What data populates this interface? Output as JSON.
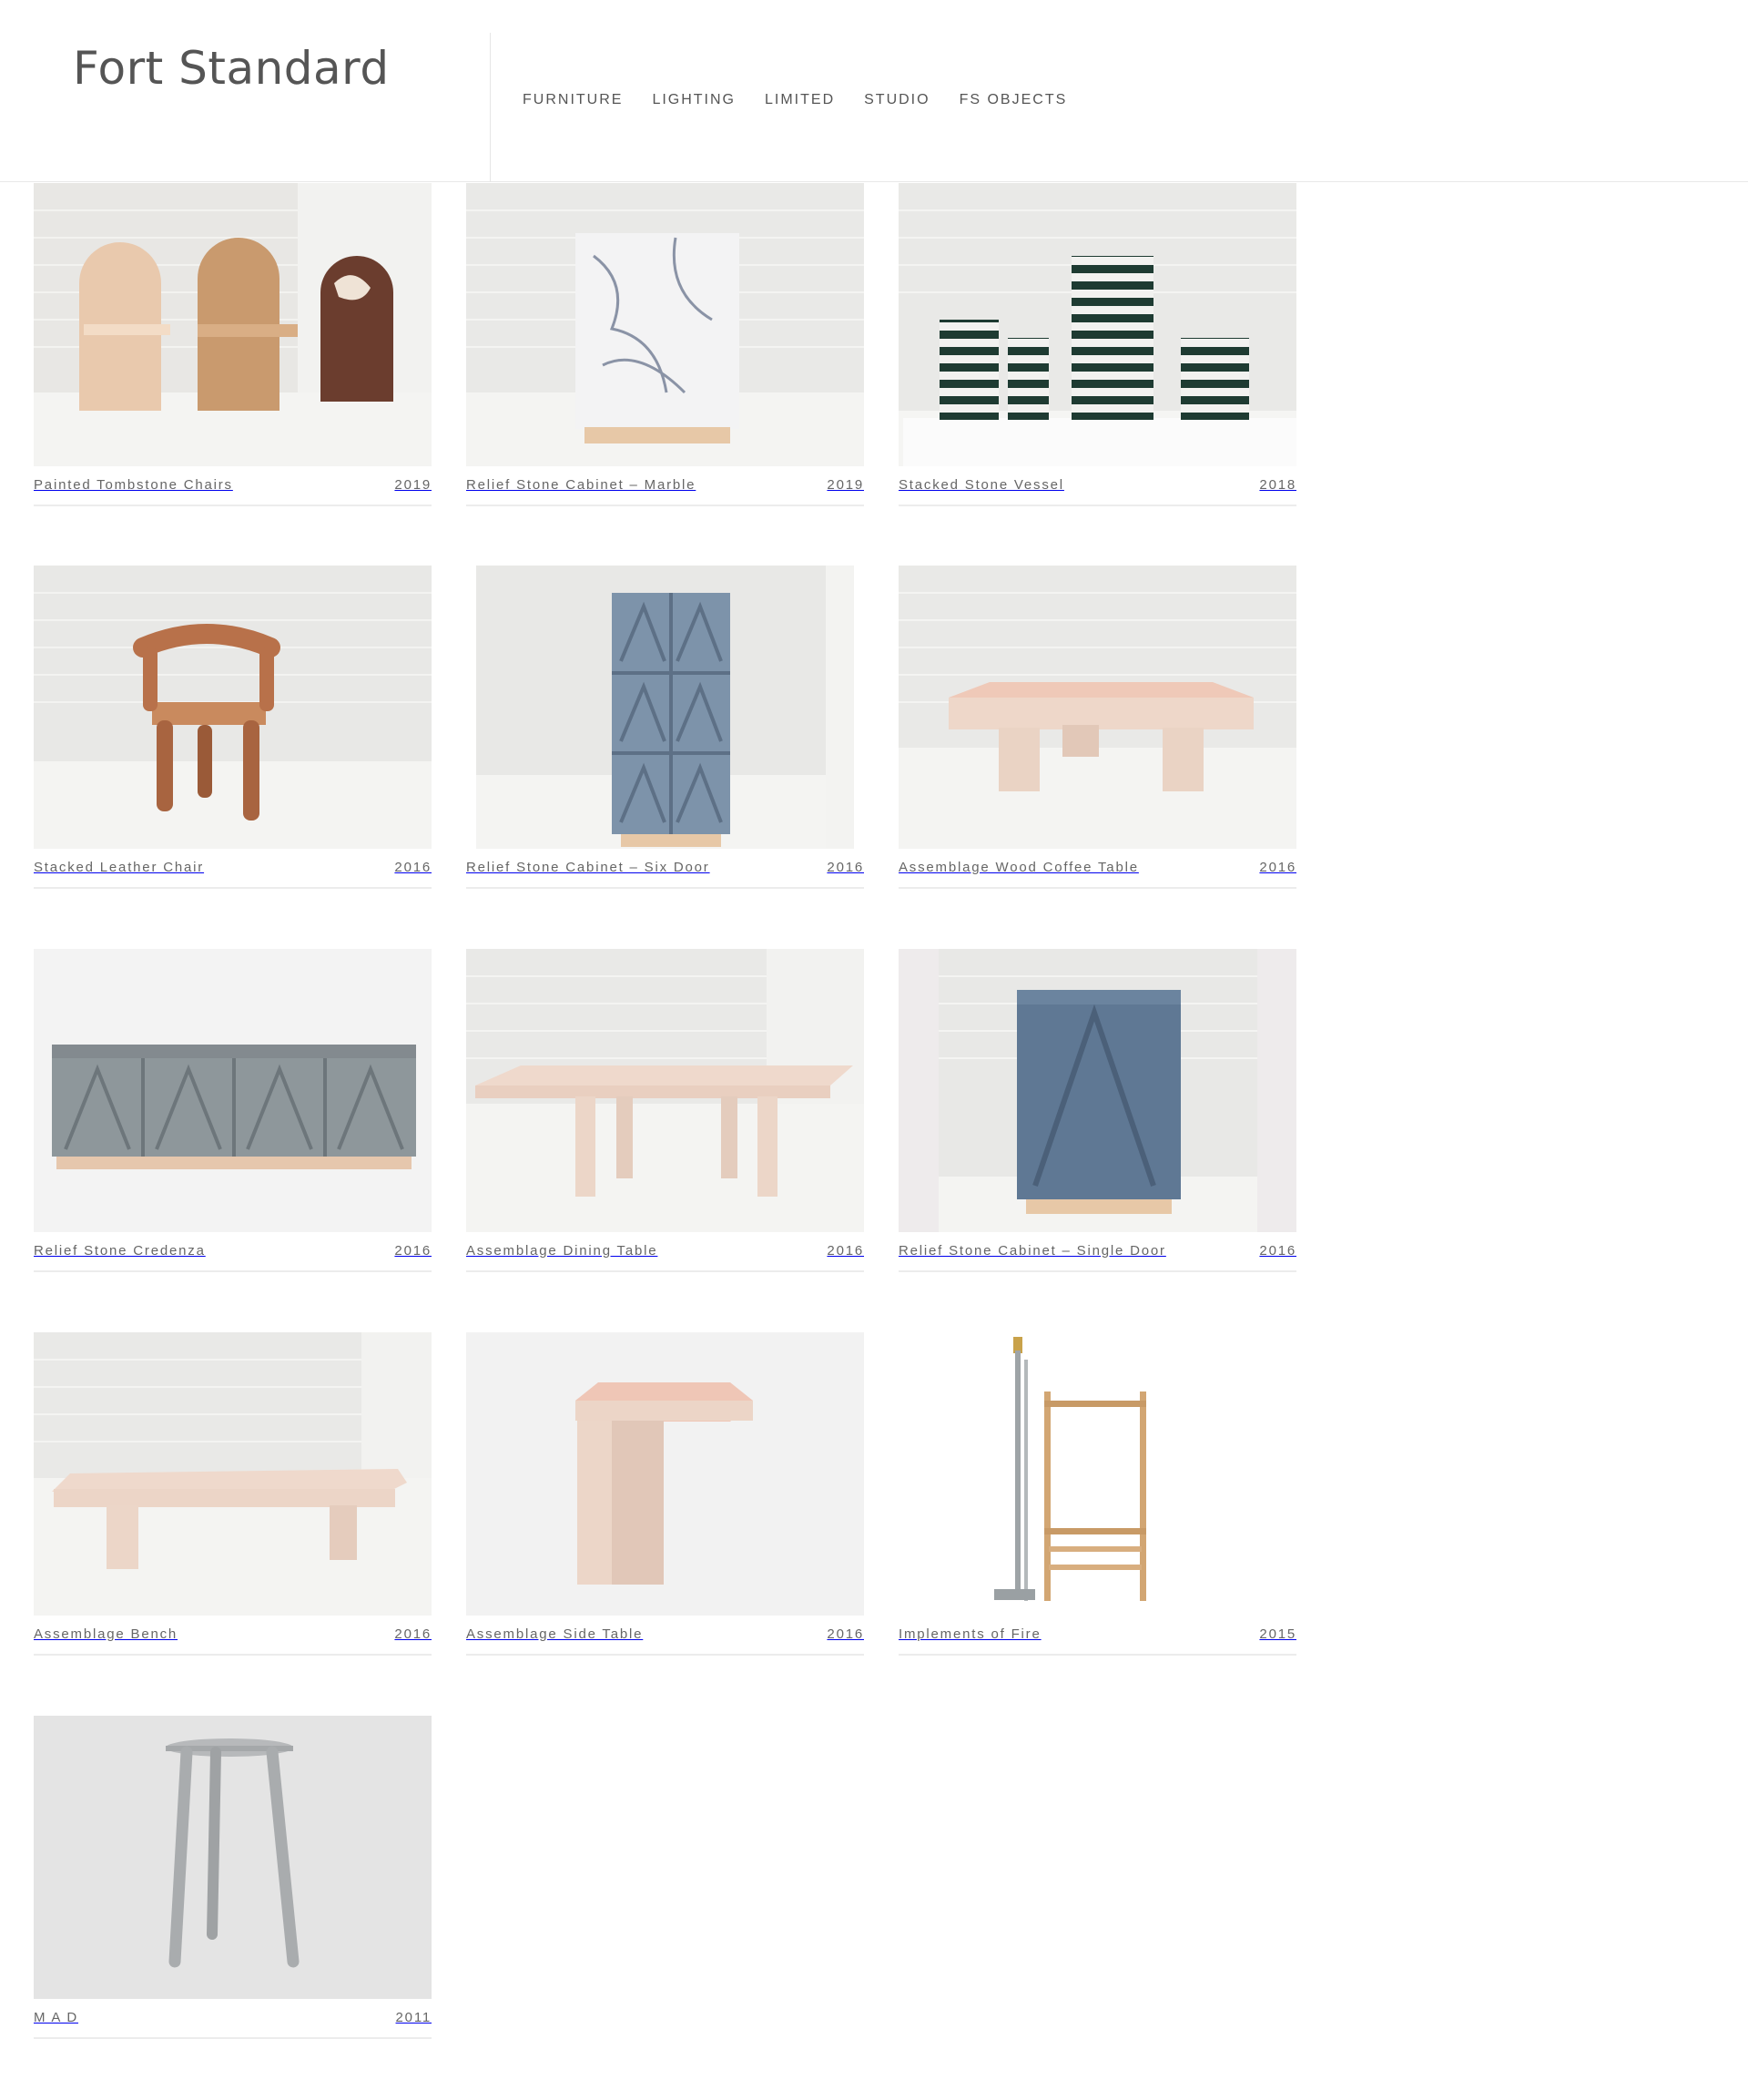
{
  "brand": {
    "name": "Fort Standard"
  },
  "nav": [
    {
      "label": "FURNITURE"
    },
    {
      "label": "LIGHTING"
    },
    {
      "label": "LIMITED"
    },
    {
      "label": "STUDIO"
    },
    {
      "label": "FS OBJECTS"
    }
  ],
  "products": [
    {
      "title": "Painted Tombstone Chairs",
      "year": "2019",
      "image": "painted-tombstone-chairs"
    },
    {
      "title": "Relief Stone Cabinet – Marble",
      "year": "2019",
      "image": "relief-stone-cabinet-marble"
    },
    {
      "title": "Stacked Stone Vessel",
      "year": "2018",
      "image": "stacked-stone-vessel"
    },
    {
      "title": "Stacked Leather Chair",
      "year": "2016",
      "image": "stacked-leather-chair"
    },
    {
      "title": "Relief Stone Cabinet – Six Door",
      "year": "2016",
      "image": "relief-stone-cabinet-six-door"
    },
    {
      "title": "Assemblage Wood Coffee Table",
      "year": "2016",
      "image": "assemblage-wood-coffee-table"
    },
    {
      "title": "Relief Stone Credenza",
      "year": "2016",
      "image": "relief-stone-credenza"
    },
    {
      "title": "Assemblage Dining Table",
      "year": "2016",
      "image": "assemblage-dining-table"
    },
    {
      "title": "Relief Stone Cabinet – Single Door",
      "year": "2016",
      "image": "relief-stone-cabinet-single-door"
    },
    {
      "title": "Assemblage Bench",
      "year": "2016",
      "image": "assemblage-bench"
    },
    {
      "title": "Assemblage Side Table",
      "year": "2016",
      "image": "assemblage-side-table"
    },
    {
      "title": "Implements of Fire",
      "year": "2015",
      "image": "implements-of-fire"
    },
    {
      "title": "M A D",
      "year": "2011",
      "image": "mad-stool"
    }
  ]
}
